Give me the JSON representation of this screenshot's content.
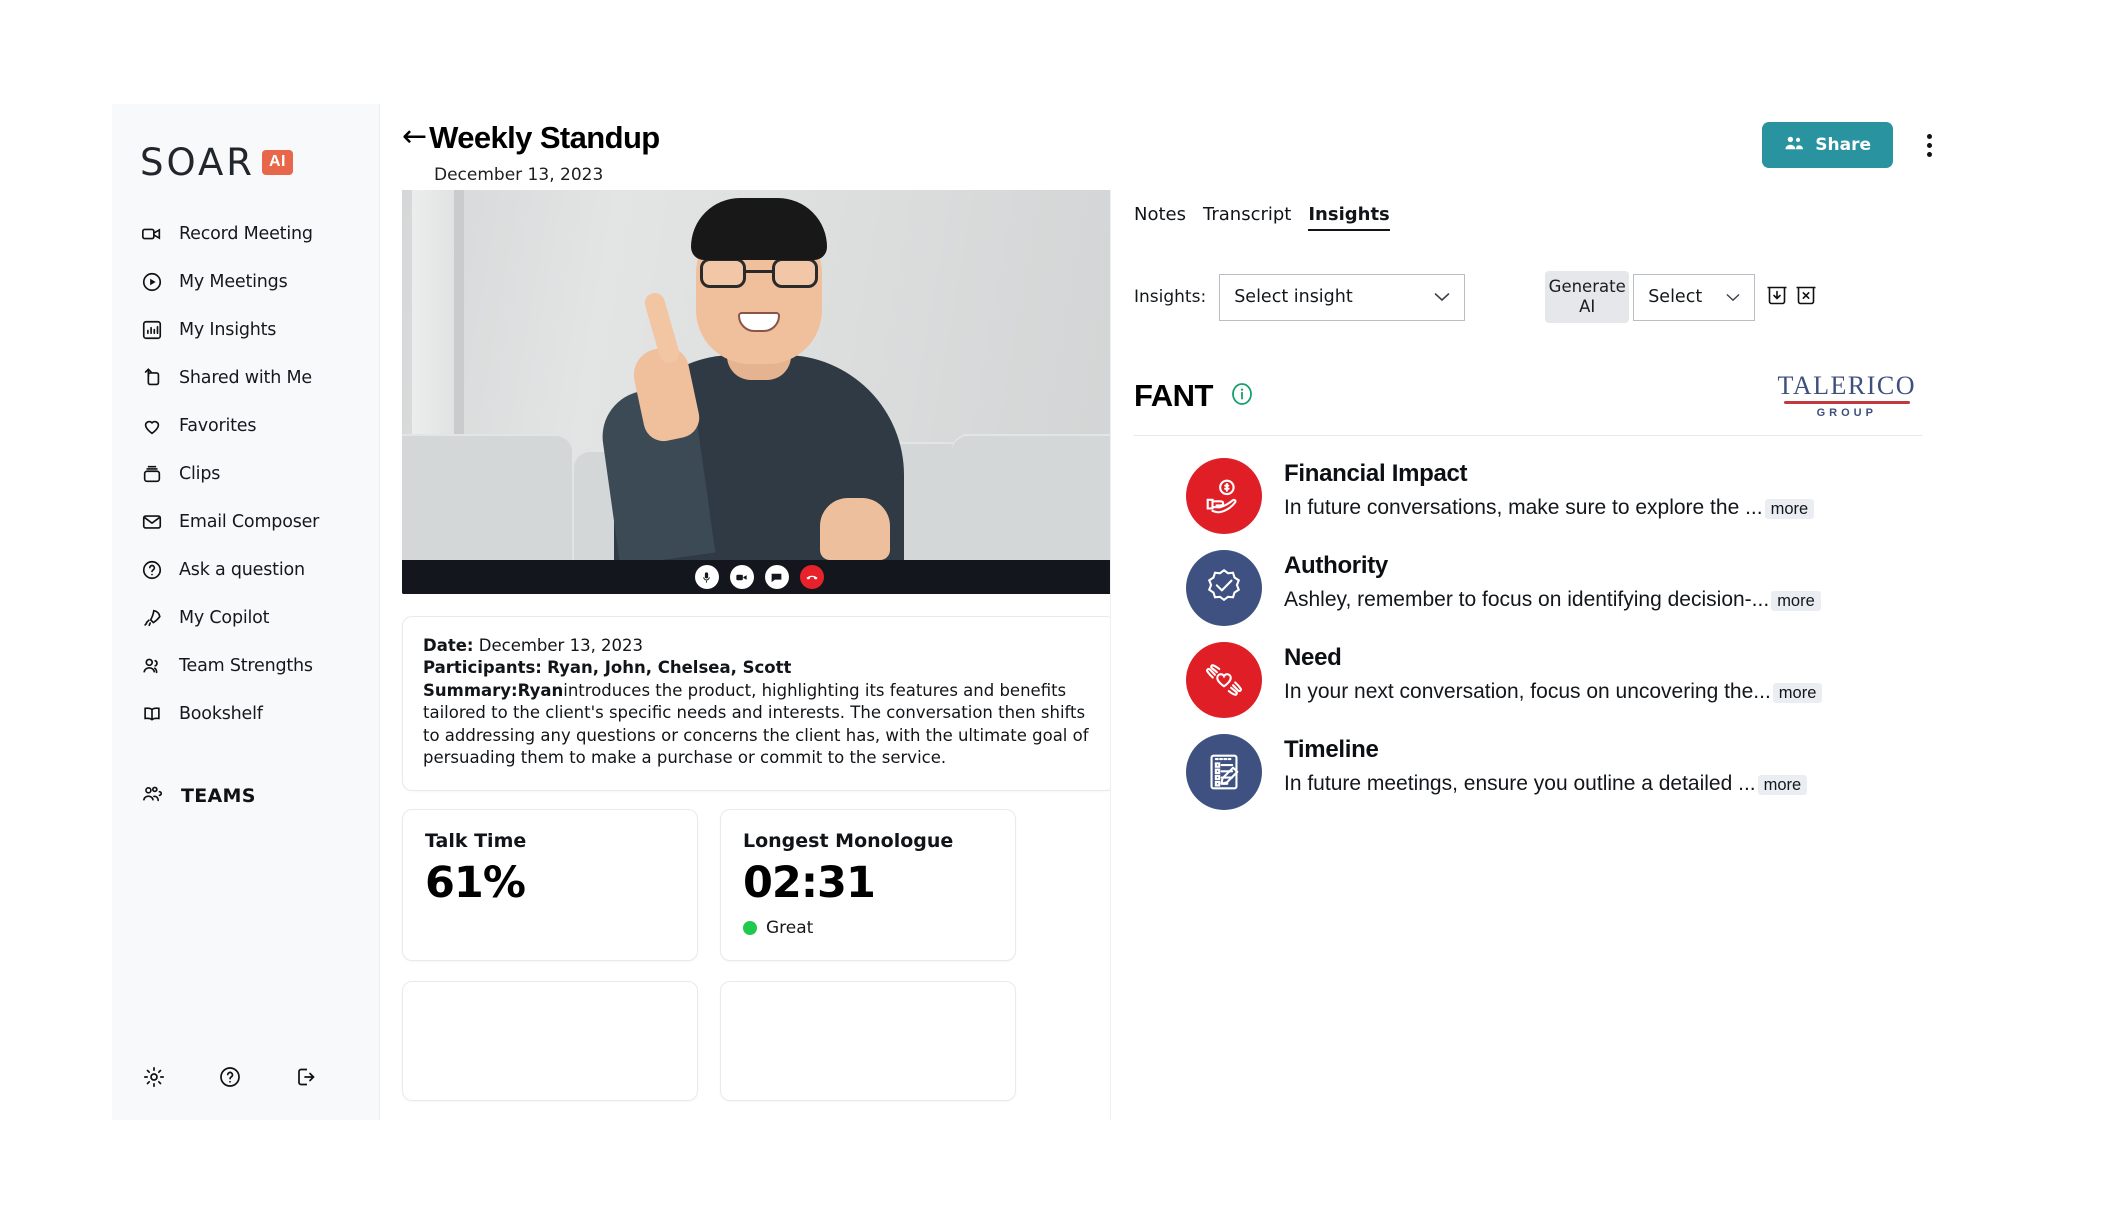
{
  "brand": {
    "logo_word": "SOAR",
    "logo_badge": "AI",
    "badge_color": "#e8664a"
  },
  "sidebar": {
    "items": [
      {
        "label": "Record Meeting",
        "icon": "video-camera-icon"
      },
      {
        "label": "My Meetings",
        "icon": "play-circle-icon"
      },
      {
        "label": "My Insights",
        "icon": "bar-chart-icon"
      },
      {
        "label": "Shared with Me",
        "icon": "share-upload-icon"
      },
      {
        "label": "Favorites",
        "icon": "heart-icon"
      },
      {
        "label": "Clips",
        "icon": "clips-box-icon"
      },
      {
        "label": "Email Composer",
        "icon": "envelope-icon"
      },
      {
        "label": "Ask a question",
        "icon": "question-circle-icon"
      },
      {
        "label": "My Copilot",
        "icon": "rocket-icon"
      },
      {
        "label": "Team Strengths",
        "icon": "users-icon"
      },
      {
        "label": "Bookshelf",
        "icon": "open-book-icon"
      }
    ],
    "teams_label": "TEAMS",
    "teams_icon": "group-people-icon",
    "footer_icons": [
      "gear-icon",
      "help-circle-icon",
      "logout-icon"
    ]
  },
  "header": {
    "back_arrow": "←",
    "title": "Weekly Standup",
    "date": "December 13, 2023",
    "share_label": "Share",
    "share_color": "#2a93a0",
    "share_icon": "people-icon",
    "menu_icon": "kebab-menu-icon"
  },
  "video": {
    "controls": [
      "microphone-icon",
      "camera-icon",
      "chat-icon",
      "end-call-icon"
    ],
    "end_call_color": "#e8222a"
  },
  "summary": {
    "date_label": "Date:",
    "date_value": "December 13, 2023",
    "participants_label": "Participants:",
    "participants_value": "Ryan, John, Chelsea, Scott",
    "summary_label": "Summary:",
    "summary_speaker": "Ryan",
    "summary_text": "introduces the product, highlighting its features and benefits tailored to the client's specific needs and interests. The conversation then shifts to addressing any questions or concerns the client has, with the ultimate goal of persuading them to make a purchase or commit to the service."
  },
  "metrics": [
    {
      "title": "Talk Time",
      "value": "61%",
      "status": "",
      "status_color": ""
    },
    {
      "title": "Longest Monologue",
      "value": "02:31",
      "status": "Great",
      "status_color": "#1fc94b"
    }
  ],
  "right_panel": {
    "tabs": [
      {
        "label": "Notes",
        "active": false
      },
      {
        "label": "Transcript",
        "active": false
      },
      {
        "label": "Insights",
        "active": true
      }
    ],
    "insights_label": "Insights:",
    "insight_select_value": "Select insight",
    "generate_label": "Generate AI",
    "second_select_value": "Select",
    "action_icons": [
      "download-box-icon",
      "delete-box-icon"
    ],
    "section_title": "FANT",
    "info_icon": "info-circle-icon",
    "info_icon_color": "#13a06a",
    "partner_logo": {
      "name": "TALERICO",
      "sub": "GROUP",
      "name_color": "#3f4f7d",
      "swoosh_color": "#c0393f"
    },
    "items": [
      {
        "title": "Financial Impact",
        "text": "In future conversations, make sure to explore the ...",
        "more": "more",
        "icon": "hand-holding-coin-icon",
        "color": "#e01e26",
        "style": "red"
      },
      {
        "title": "Authority",
        "text": "Ashley, remember to focus on identifying decision-...",
        "more": "more",
        "icon": "badge-check-icon",
        "color": "#3f5181",
        "style": "navy"
      },
      {
        "title": "Need",
        "text": "In your next conversation, focus on uncovering the...",
        "more": "more",
        "icon": "hands-heart-icon",
        "color": "#e01e26",
        "style": "red"
      },
      {
        "title": "Timeline",
        "text": "In future meetings, ensure you outline a detailed ...",
        "more": "more",
        "icon": "checklist-pencil-icon",
        "color": "#3f5181",
        "style": "navy"
      }
    ]
  }
}
